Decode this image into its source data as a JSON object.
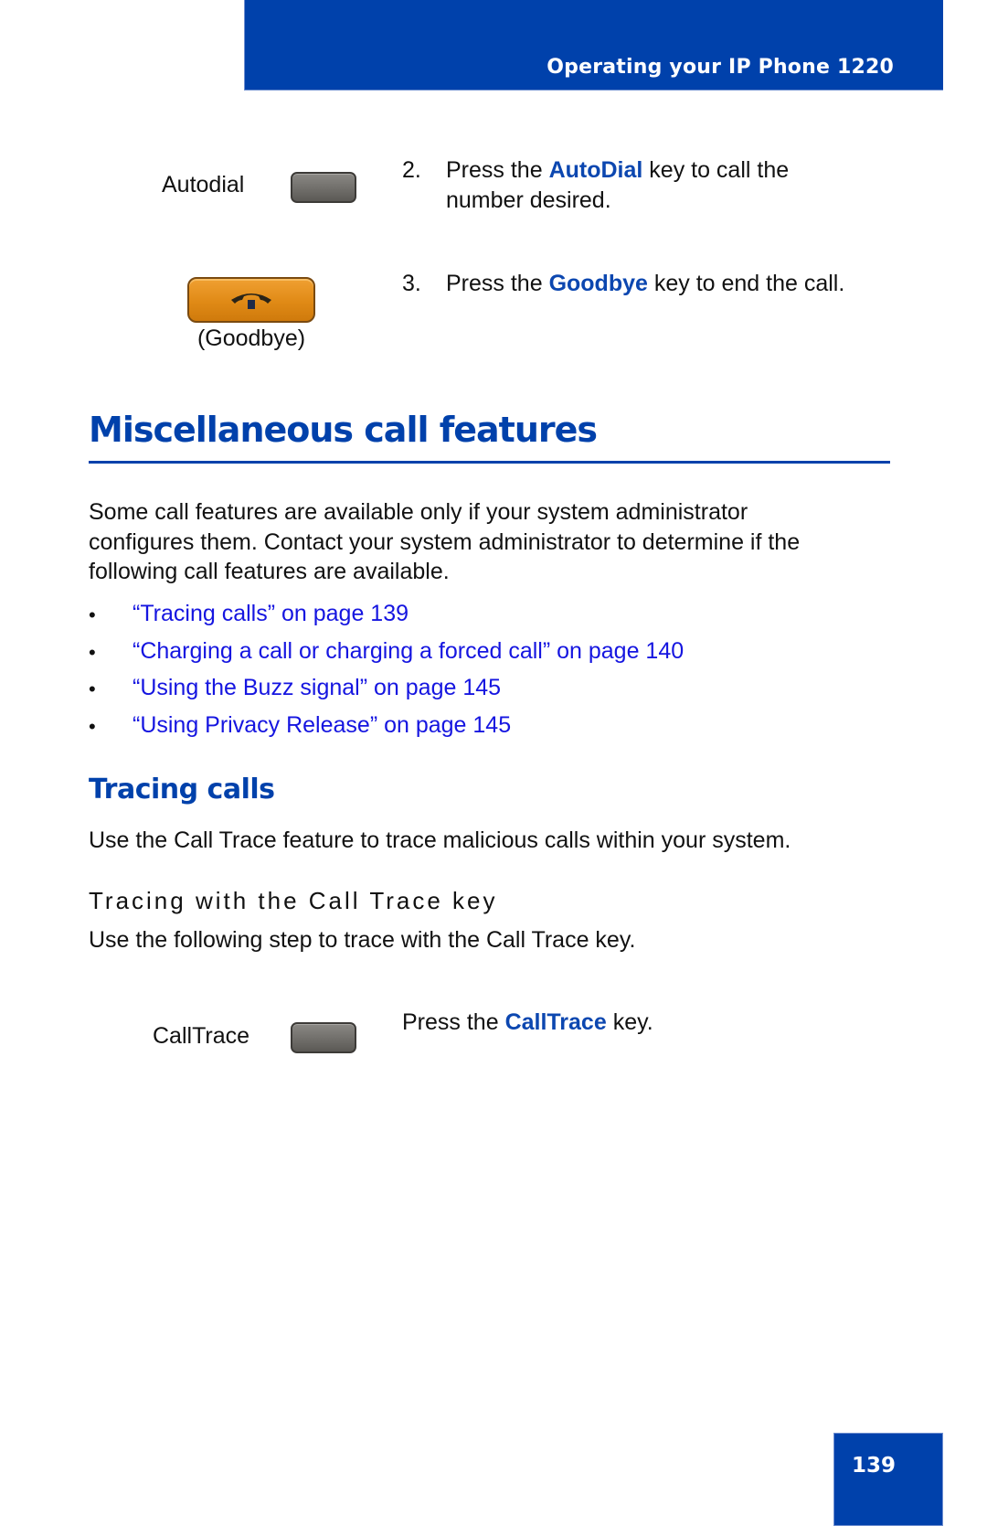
{
  "header": {
    "title": "Operating your IP Phone 1220",
    "band_color": "#0041ab"
  },
  "steps_top": [
    {
      "key_label": "Autodial",
      "key_icon": "softkey-blank-gray",
      "number": "2.",
      "text_before": "Press the ",
      "keyword": "AutoDial",
      "text_after_line1": " key to call the",
      "text_line2": "number desired."
    },
    {
      "key_caption": "(Goodbye)",
      "key_icon": "goodbye-handset-orange",
      "number": "3.",
      "text_before": "Press the ",
      "keyword": "Goodbye",
      "text_after": " key to end the call."
    }
  ],
  "section": {
    "title": "Miscellaneous call features",
    "intro_lines": [
      "Some call features are available only if your system administrator",
      "configures them. Contact your system administrator to determine if the",
      "following call features are available."
    ],
    "bullet_glyph": "•",
    "links": [
      "“Tracing calls” on page 139",
      "“Charging a call or charging a forced call” on page 140",
      "“Using the Buzz signal” on page 145",
      "“Using Privacy Release” on page 145"
    ]
  },
  "subsection": {
    "title": "Tracing calls",
    "intro": "Use the Call Trace feature to trace malicious calls within your system.",
    "procedure_title": "Tracing with the Call Trace key",
    "procedure_intro": "Use the following step to trace with the Call Trace key.",
    "step": {
      "key_label": "CallTrace",
      "key_icon": "softkey-blank-gray",
      "text_before": "Press the ",
      "keyword": "CallTrace",
      "text_after": " key."
    }
  },
  "footer": {
    "page_number": "139"
  },
  "colors": {
    "brand_blue": "#0041ab",
    "keyword_blue": "#0c47b0",
    "link_blue": "#1515e0",
    "goodbye_orange": "#e08a16",
    "softkey_gray": "#6e6c68"
  }
}
